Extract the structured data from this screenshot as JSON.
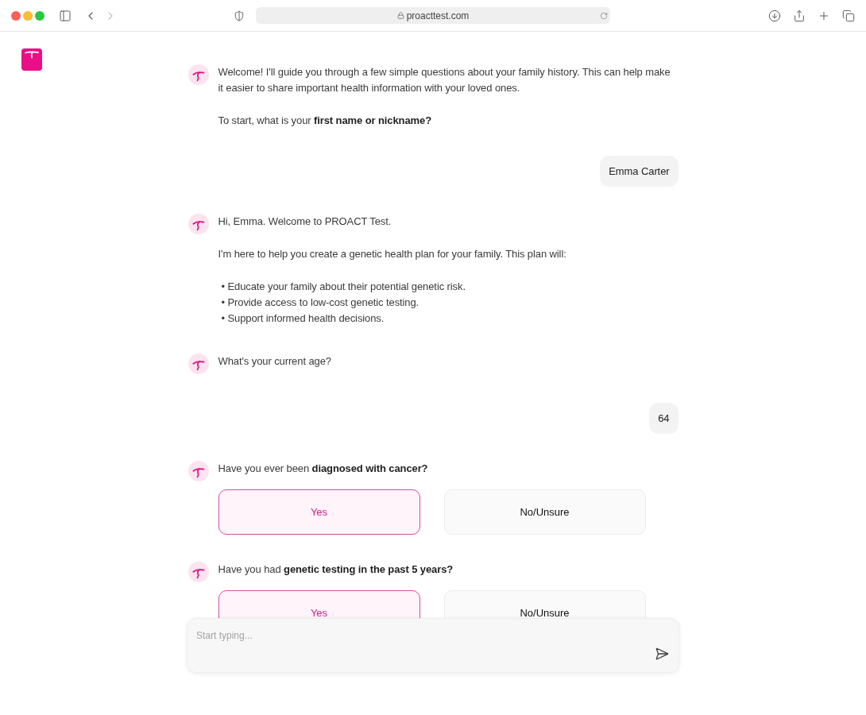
{
  "browser": {
    "nav": [
      {
        "kind": "back",
        "disabled": false
      },
      {
        "kind": "forward",
        "disabled": true
      }
    ],
    "address": "proacttest.com"
  },
  "messages": [
    {
      "kind": "bot",
      "blocks": [
        {
          "kind": "text",
          "text": "Welcome! I'll guide you through a few simple questions about your family history. This can help make it easier to share important health information with your loved ones."
        },
        {
          "kind": "text",
          "text": "To start, what is your **first name or nickname?**"
        }
      ]
    },
    {
      "kind": "user",
      "text": "Emma Carter"
    },
    {
      "kind": "bot",
      "blocks": [
        {
          "kind": "text",
          "text": "Hi, Emma. Welcome to PROACT Test."
        },
        {
          "kind": "text",
          "text": "I'm here to help you create a genetic health plan for your family. This plan will:"
        },
        {
          "kind": "list",
          "items": [
            "• Educate your family about their potential genetic risk.",
            "• Provide access to low-cost genetic testing.",
            "• Support informed health decisions."
          ]
        }
      ]
    },
    {
      "kind": "bot",
      "blocks": [
        {
          "kind": "text",
          "text": "What's your current age?"
        }
      ]
    },
    {
      "kind": "user",
      "text": "64"
    },
    {
      "kind": "bot",
      "blocks": [
        {
          "kind": "text",
          "text": "Have you ever been **diagnosed with cancer?**"
        }
      ],
      "options": [
        {
          "label": "Yes",
          "selected": true
        },
        {
          "label": "No/Unsure",
          "selected": false
        }
      ]
    },
    {
      "kind": "bot",
      "blocks": [
        {
          "kind": "text",
          "text": "Have you had **genetic testing in the past 5 years?**"
        }
      ],
      "options": [
        {
          "label": "Yes",
          "selected": true
        },
        {
          "label": "No/Unsure",
          "selected": false
        }
      ]
    }
  ],
  "composer": {
    "placeholder": "Start typing..."
  }
}
